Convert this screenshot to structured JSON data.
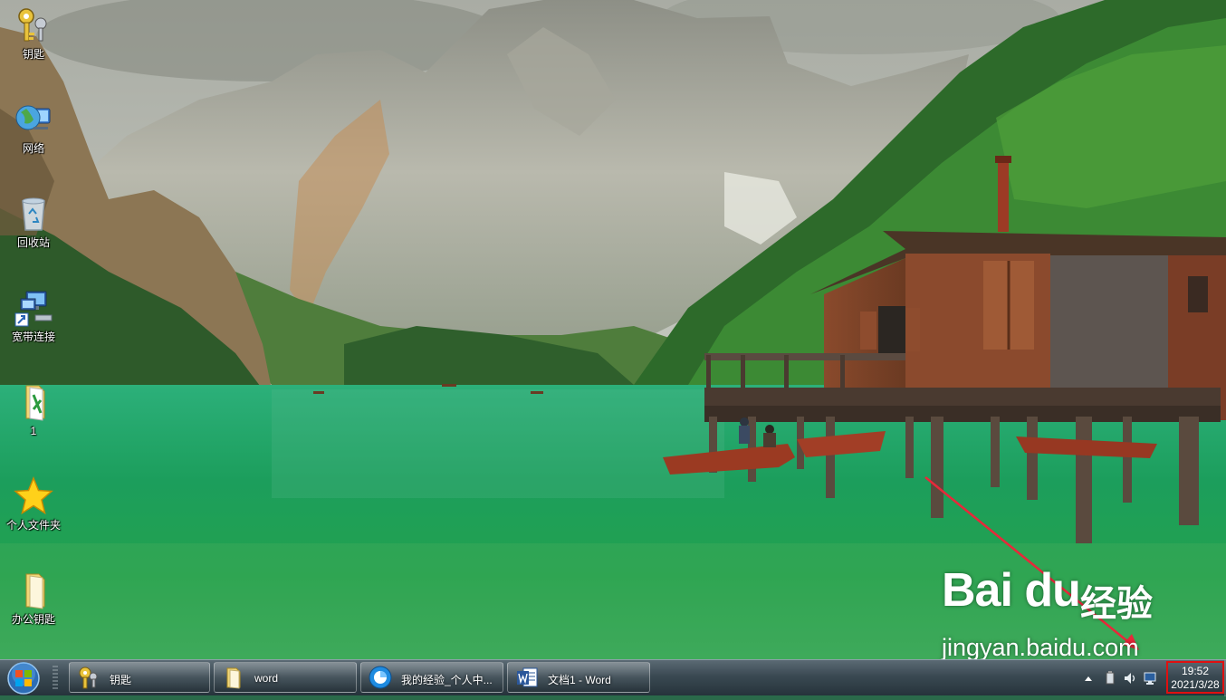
{
  "desktop": {
    "icons": [
      {
        "label": "钥匙",
        "icon": "keys-icon"
      },
      {
        "label": "网络",
        "icon": "network-globe-icon"
      },
      {
        "label": "回收站",
        "icon": "recycle-bin-icon"
      },
      {
        "label": "宽带连接",
        "icon": "broadband-connection-icon"
      },
      {
        "label": "1",
        "icon": "folder-document-icon"
      },
      {
        "label": "个人文件夹",
        "icon": "star-icon"
      },
      {
        "label": "办公钥匙",
        "icon": "folder-icon"
      }
    ]
  },
  "taskbar": {
    "start_icon": "windows-start-orb-icon",
    "buttons": [
      {
        "label": "钥匙",
        "icon": "keys-icon"
      },
      {
        "label": "word",
        "icon": "folder-icon"
      },
      {
        "label": "我的经验_个人中...",
        "icon": "browser-icon"
      },
      {
        "label": "文档1 - Word",
        "icon": "word-icon"
      }
    ],
    "tray_icons": [
      "show-hidden-icons-arrow-icon",
      "usb-device-icon",
      "volume-icon",
      "network-status-icon"
    ],
    "clock": {
      "time": "19:52",
      "date": "2021/3/28"
    }
  },
  "watermark": {
    "logo": "Bai du",
    "brand_cn": "经验",
    "url": "jingyan.baidu.com"
  },
  "colors": {
    "highlight_box": "#e01010",
    "arrow": "#e8283a",
    "taskbar": "#3a4952"
  }
}
